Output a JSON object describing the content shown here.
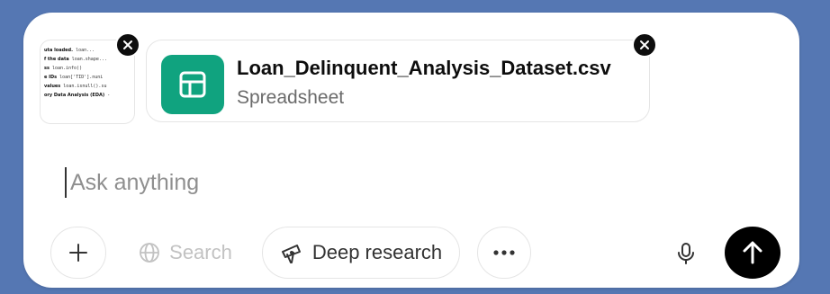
{
  "attachments": {
    "image_thumbnail": {
      "lines": [
        {
          "bold": "uta loaded.",
          "mono": "loan..."
        },
        {
          "bold": "f the data",
          "mono": "loan.shape..."
        },
        {
          "bold": "ss",
          "mono": "loan.info()"
        },
        {
          "bold": "e IDs",
          "mono": "loan['TID'].nuni"
        },
        {
          "bold": "values",
          "mono": "loan.isnull().su"
        },
        {
          "bold": "ory Data Analysis (EDA)",
          "mono": "-"
        }
      ]
    },
    "file": {
      "name": "Loan_Delinquent_Analysis_Dataset.csv",
      "type": "Spreadsheet",
      "icon": "spreadsheet-icon",
      "icon_color": "#10a37f"
    }
  },
  "prompt": {
    "placeholder": "Ask anything",
    "value": ""
  },
  "toolbar": {
    "add_icon": "plus-icon",
    "search_label": "Search",
    "search_icon": "globe-icon",
    "deep_research_label": "Deep research",
    "deep_research_icon": "telescope-icon",
    "more_icon": "ellipsis-icon",
    "mic_icon": "microphone-icon",
    "send_icon": "arrow-up-icon"
  },
  "colors": {
    "background": "#5577b3",
    "send_button": "#000000",
    "file_icon_bg": "#10a37f"
  }
}
